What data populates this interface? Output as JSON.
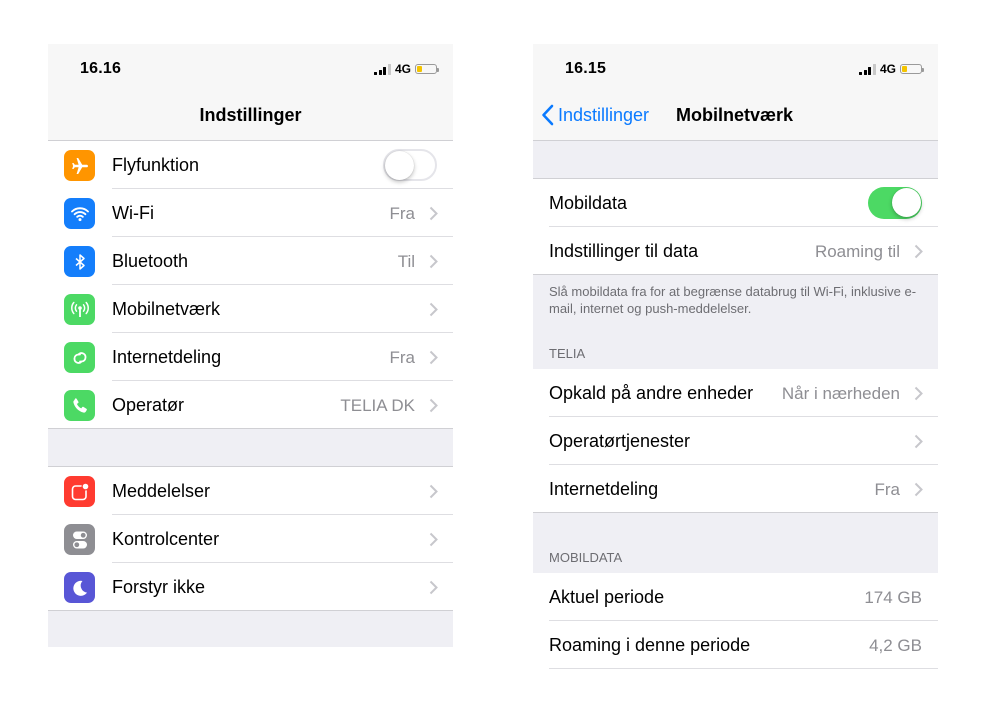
{
  "left": {
    "time": "16.16",
    "network": "4G",
    "battery_level": 0.25,
    "title": "Indstillinger",
    "group1": [
      {
        "label": "Flyfunktion",
        "value": "",
        "icon": "airplane-icon",
        "color": "#ff9500"
      },
      {
        "label": "Wi-Fi",
        "value": "Fra",
        "icon": "wifi-icon",
        "color": "#147efb"
      },
      {
        "label": "Bluetooth",
        "value": "Til",
        "icon": "bluetooth-icon",
        "color": "#147efb"
      },
      {
        "label": "Mobilnetværk",
        "value": "",
        "icon": "antenna-icon",
        "color": "#4cd964"
      },
      {
        "label": "Internetdeling",
        "value": "Fra",
        "icon": "hotspot-icon",
        "color": "#4cd964"
      },
      {
        "label": "Operatør",
        "value": "TELIA DK",
        "icon": "phone-icon",
        "color": "#4cd964"
      }
    ],
    "group2": [
      {
        "label": "Meddelelser",
        "icon": "notifications-icon",
        "color": "#ff3b30"
      },
      {
        "label": "Kontrolcenter",
        "icon": "control-center-icon",
        "color": "#8e8e93"
      },
      {
        "label": "Forstyr ikke",
        "icon": "moon-icon",
        "color": "#5856d6"
      }
    ],
    "airplane_mode_on": false
  },
  "right": {
    "time": "16.15",
    "network": "4G",
    "battery_level": 0.25,
    "back_label": "Indstillinger",
    "title": "Mobilnetværk",
    "mobile_data": {
      "label": "Mobildata",
      "on": true
    },
    "data_settings": {
      "label": "Indstillinger til data",
      "value": "Roaming til"
    },
    "footnote": "Slå mobildata fra for at begrænse databrug til Wi-Fi, inklusive e-mail, internet og push-meddelelser.",
    "telia_header": "TELIA",
    "telia_rows": [
      {
        "label": "Opkald på andre enheder",
        "value": "Når i nærheden"
      },
      {
        "label": "Operatørtjenester",
        "value": ""
      },
      {
        "label": "Internetdeling",
        "value": "Fra"
      }
    ],
    "mobildata_header": "MOBILDATA",
    "usage_rows": [
      {
        "label": "Aktuel periode",
        "value": "174 GB"
      },
      {
        "label": "Roaming i denne periode",
        "value": "4,2 GB"
      }
    ]
  },
  "colors": {
    "accent": "#0a7aff",
    "switch_on": "#4cd964",
    "battery": "#f4c400"
  }
}
